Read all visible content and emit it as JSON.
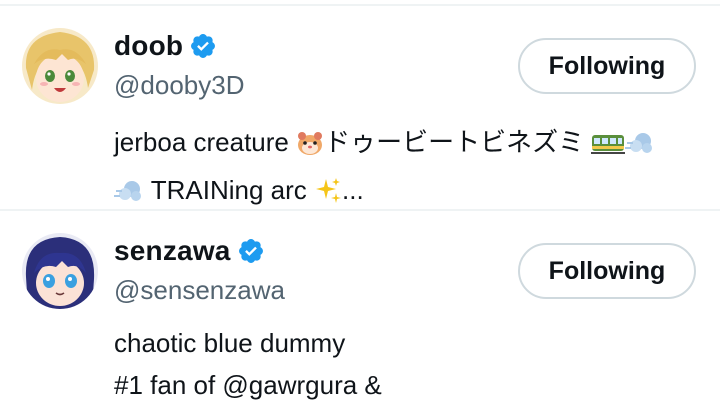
{
  "users": [
    {
      "display_name": "doob",
      "handle": "@dooby3D",
      "follow_label": "Following",
      "bio_line1_text": "jerboa creature ",
      "bio_line1_jp": "ドゥービートビネズミ",
      "bio_line2_text": " TRAINing arc ",
      "bio_line2_end": "...",
      "avatar_icon": "anime-avatar-blonde-icon",
      "verified_icon": "verified-badge-icon"
    },
    {
      "display_name": "senzawa",
      "handle": "@sensenzawa",
      "follow_label": "Following",
      "bio_line1": "chaotic blue dummy",
      "bio_line2": "#1 fan of @gawrgura &",
      "avatar_icon": "anime-avatar-blue-hair-icon",
      "verified_icon": "verified-badge-icon"
    }
  ],
  "colors": {
    "verified_blue": "#1d9bf0",
    "handle_gray": "#536471",
    "divider": "#eff3f4",
    "button_border": "#cfd9de"
  }
}
